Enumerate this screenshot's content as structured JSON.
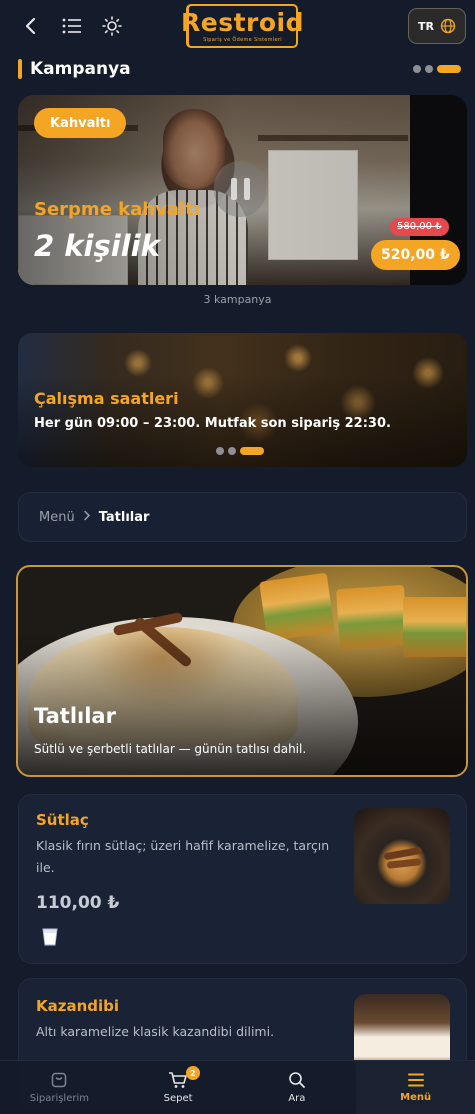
{
  "header": {
    "logo_text": "Restroid",
    "logo_tagline": "Sipariş ve Ödeme Sistemleri",
    "language": "TR"
  },
  "campaign_section": {
    "title": "Kampanya",
    "count_text": "3 kampanya",
    "card": {
      "badge": "Kahvaltı",
      "title": "Serpme kahvaltı",
      "subtitle": "2 kişilik",
      "old_price": "580,00 ₺",
      "new_price": "520,00 ₺"
    }
  },
  "hours_card": {
    "title": "Çalışma saatleri",
    "text": "Her gün 09:00 – 23:00. Mutfak son sipariş 22:30."
  },
  "breadcrumb": {
    "root": "Menü",
    "current": "Tatlılar"
  },
  "category": {
    "title": "Tatlılar",
    "description": "Sütlü ve şerbetli tatlılar — günün tatlısı dahil."
  },
  "products": [
    {
      "name": "Sütlaç",
      "description": "Klasik fırın sütlaç; üzeri hafif karamelize, tarçın ile.",
      "price": "110,00 ₺"
    },
    {
      "name": "Kazandibi",
      "description": "Altı karamelize klasik kazandibi dilimi."
    }
  ],
  "bottom_nav": {
    "orders": "Siparişlerim",
    "cart": "Sepet",
    "cart_count": "2",
    "search": "Ara",
    "menu": "Menü"
  },
  "colors": {
    "accent": "#f5a524",
    "background": "#141b2b",
    "card": "#1a2335",
    "sale_red": "#e5484d"
  }
}
